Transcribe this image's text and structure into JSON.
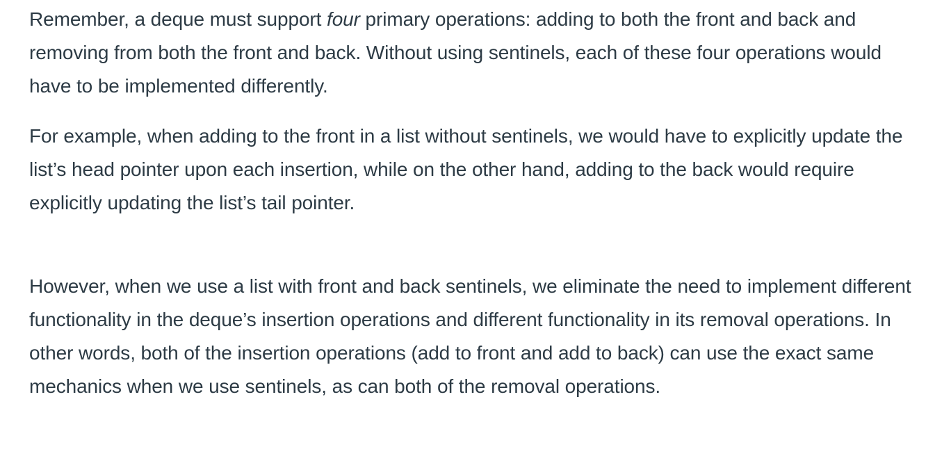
{
  "paragraphs": {
    "p1": {
      "before": "Remember, a deque must support ",
      "emphasis": "four",
      "after": " primary operations: adding to both the front and back and removing from both the front and back.  Without using sentinels, each of these four operations would have to be implemented differently."
    },
    "p2": {
      "text": "For example, when adding to the front in a list without sentinels, we would have to explicitly update the list’s head pointer upon each insertion, while on the other hand, adding to the back would require explicitly updating the list’s tail pointer."
    },
    "p3": {
      "text": "However, when we use a list with front and back sentinels, we eliminate the need to implement different functionality in the deque’s insertion operations and different functionality in its removal operations.  In other words, both of the insertion operations (add to front and add to back) can use the exact same mechanics when we use sentinels, as can both of the removal operations."
    }
  }
}
